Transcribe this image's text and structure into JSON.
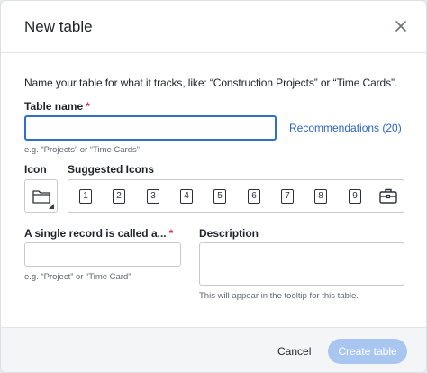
{
  "dialog": {
    "title": "New table",
    "intro": "Name your table for what it tracks, like: “Construction Projects” or “Time Cards”."
  },
  "table_name": {
    "label": "Table name",
    "required_mark": "*",
    "value": "",
    "hint": "e.g. “Projects” or “Time Cards”",
    "recommendations_link": "Recommendations (20)"
  },
  "icon": {
    "label": "Icon",
    "selected_icon": "folder-icon"
  },
  "suggested_icons": {
    "label": "Suggested Icons",
    "items": [
      "1",
      "2",
      "3",
      "4",
      "5",
      "6",
      "7",
      "8",
      "9"
    ],
    "last_icon": "briefcase-icon"
  },
  "record": {
    "label": "A single record is called a...",
    "required_mark": "*",
    "value": "",
    "hint": "e.g. “Project” or “Time Card”"
  },
  "description": {
    "label": "Description",
    "value": "",
    "hint": "This will appear in the tooltip for this table."
  },
  "footer": {
    "cancel_label": "Cancel",
    "create_label": "Create table"
  },
  "colors": {
    "accent": "#2f6ecc",
    "link": "#2a64c5",
    "required": "#d9364f",
    "create_disabled": "#a9c6f1"
  }
}
